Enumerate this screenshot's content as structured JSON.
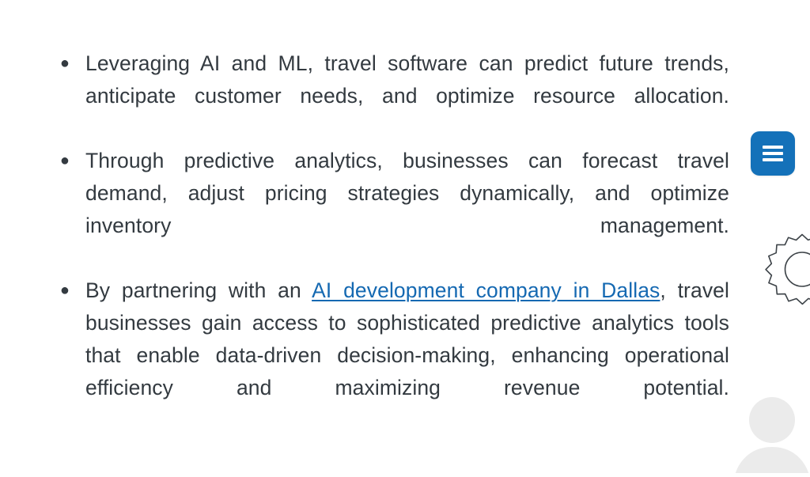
{
  "slide": {
    "background_color": "#ffffff",
    "text_color": "#333a40",
    "accent_color": "#1471b9",
    "link_color": "#1569b2"
  },
  "bullets": [
    {
      "marker": "●",
      "text": "Leveraging AI and ML, travel software can predict future trends, anticipate customer needs, and optimize resource allocation."
    },
    {
      "marker": "●",
      "text": "Through predictive analytics, businesses can forecast travel demand, adjust pricing strategies dynamically, and optimize inventory management."
    },
    {
      "marker": "●",
      "text_before_link": "By partnering with an ",
      "link_text": "AI development company in Dallas",
      "text_after_link": ", travel businesses gain access to sophisticated predictive analytics tools that enable data-driven decision-making, enhancing operational efficiency and maximizing revenue potential."
    }
  ],
  "menu_button": {
    "icon": "hamburger-menu-icon",
    "label": "",
    "background_color": "#1471b9"
  },
  "decorations": {
    "gear": {
      "icon": "gear-icon",
      "stroke_color": "#3d4348"
    },
    "avatar": {
      "icon": "person-silhouette-icon",
      "fill_color": "#ebebeb"
    }
  }
}
